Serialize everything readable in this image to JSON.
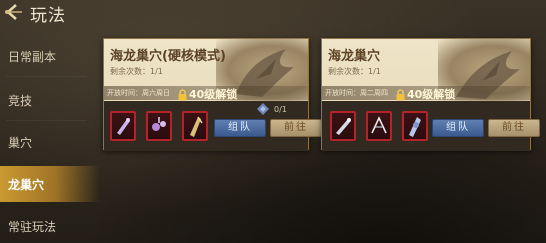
{
  "header": {
    "title": "玩法",
    "back_icon": "back-arrow-icon"
  },
  "sidebar": {
    "items": [
      {
        "label": "日常副本",
        "active": false
      },
      {
        "label": "竞技",
        "active": false
      },
      {
        "label": "巢穴",
        "active": false
      },
      {
        "label": "龙巢穴",
        "active": true
      },
      {
        "label": "常驻玩法",
        "active": false
      }
    ]
  },
  "cards": [
    {
      "title": "海龙巢穴(硬核模式)",
      "remaining": "剩余次数：1/1",
      "open_time": "开放时间：周六周日",
      "unlock": "40级解锁",
      "team_label": "组队",
      "go_label": "前往"
    },
    {
      "title": "海龙巢穴",
      "remaining": "剩余次数：1/1",
      "open_time": "开放时间：周二周四",
      "unlock": "40级解锁",
      "team_label": "组队",
      "go_label": "前往"
    }
  ],
  "progress": {
    "text": "0/1"
  },
  "colors": {
    "accent": "#d2a032",
    "reward_border": "#b4232a",
    "team_button": "#4a6b9f"
  }
}
